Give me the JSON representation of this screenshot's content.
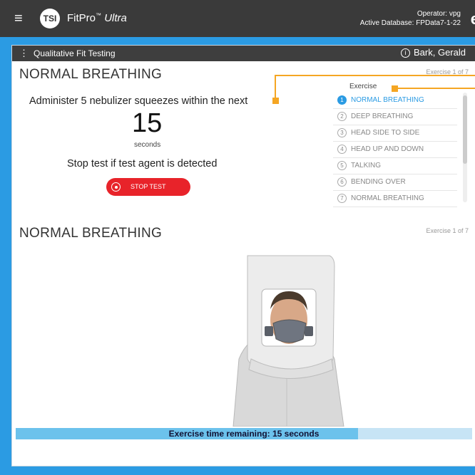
{
  "app": {
    "brand": "FitPro",
    "brand_tm": "™",
    "brand_edition": "Ultra",
    "logo_text": "TSI",
    "operator_label": "Operator:",
    "operator": "vpg",
    "database_label": "Active Database:",
    "database": "FPData7-1-22",
    "account_icon": "user-icon"
  },
  "window": {
    "title": "Qualitative Fit Testing",
    "user": "Bark, Gerald"
  },
  "current": {
    "heading": "NORMAL BREATHING",
    "progress": "Exercise 1 of 7",
    "instruction": "Administer 5 nebulizer squeezes within the next",
    "countdown": "15",
    "units": "seconds",
    "warning": "Stop test if test agent is detected",
    "stop_label": "STOP TEST"
  },
  "exercise_panel": {
    "header": "Exercise",
    "items": [
      {
        "n": "1",
        "label": "NORMAL BREATHING",
        "active": true
      },
      {
        "n": "2",
        "label": "DEEP BREATHING",
        "active": false
      },
      {
        "n": "3",
        "label": "HEAD SIDE TO SIDE",
        "active": false
      },
      {
        "n": "4",
        "label": "HEAD UP AND DOWN",
        "active": false
      },
      {
        "n": "5",
        "label": "TALKING",
        "active": false
      },
      {
        "n": "6",
        "label": "BENDING OVER",
        "active": false
      },
      {
        "n": "7",
        "label": "NORMAL BREATHING",
        "active": false
      }
    ]
  },
  "animation": {
    "heading": "NORMAL BREATHING",
    "progress": "Exercise 1 of 7"
  },
  "timer": {
    "text": "Exercise time remaining: 15 seconds",
    "elapsed_fraction": 0.75
  },
  "colors": {
    "accent": "#2b9be3",
    "stop": "#e8232a",
    "callout": "#f5a623"
  }
}
